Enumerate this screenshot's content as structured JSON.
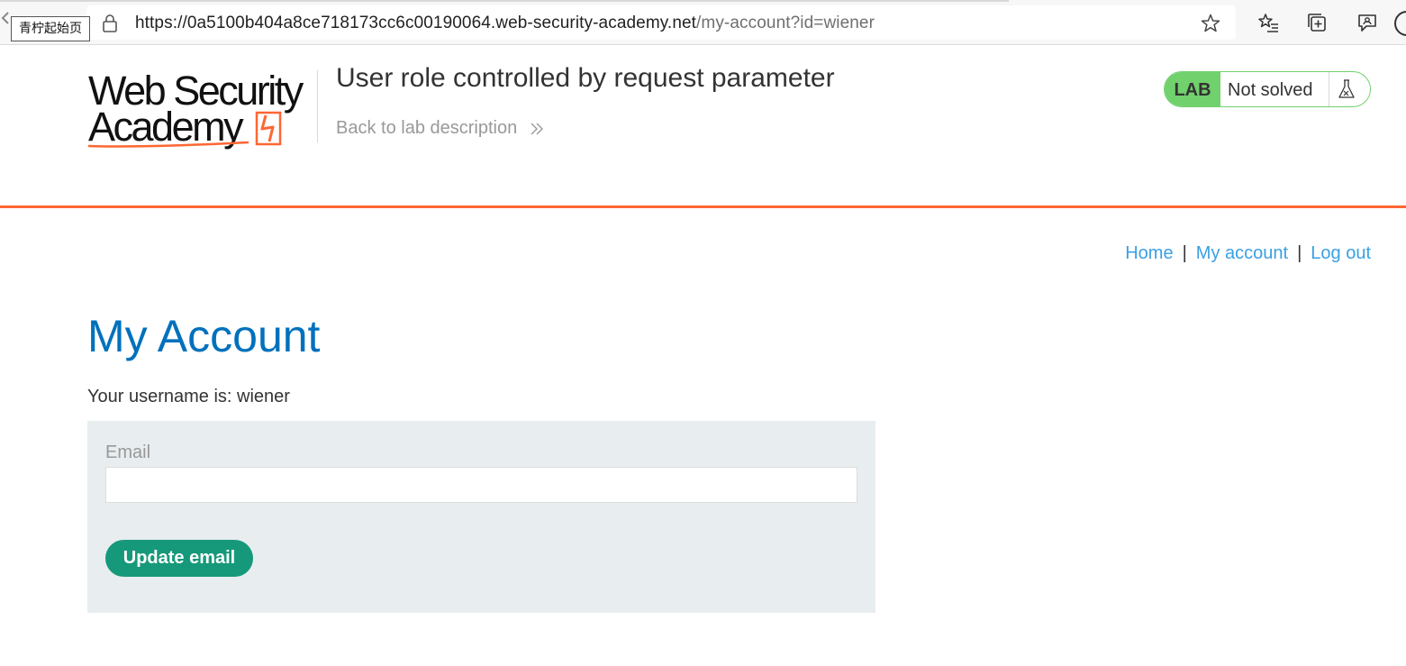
{
  "browser": {
    "tooltip": "青柠起始页",
    "url_base": "https://0a5100b404a8ce718173cc6c00190064.web-security-academy.net",
    "url_rest": "/my-account?id=wiener"
  },
  "header": {
    "logo_line1": "Web Security",
    "logo_line2": "Academy",
    "lab_title": "User role controlled by request parameter",
    "back_link": "Back to lab description",
    "status_tag": "LAB",
    "status_text": "Not solved"
  },
  "nav": {
    "home": "Home",
    "my_account": "My account",
    "log_out": "Log out",
    "separator": "|"
  },
  "main": {
    "title": "My Account",
    "username_line": "Your username is: wiener",
    "email_label": "Email",
    "email_value": "",
    "update_button": "Update email"
  },
  "colors": {
    "accent_orange": "#ff6633",
    "link_blue": "#3aa0e4",
    "title_blue": "#0071bc",
    "lab_green": "#70d16d",
    "button_green": "#16997a",
    "panel_gray": "#e8edef"
  }
}
